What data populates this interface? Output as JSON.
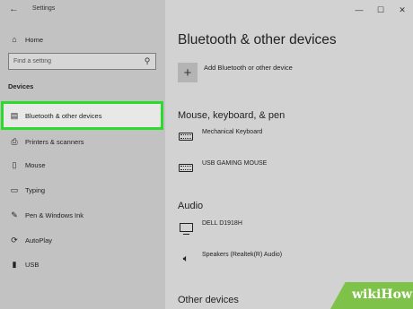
{
  "window": {
    "title": "Settings",
    "minimize": "—",
    "maximize": "☐",
    "close": "✕"
  },
  "sidebar": {
    "home_label": "Home",
    "search_placeholder": "Find a setting",
    "section_heading": "Devices",
    "items": [
      {
        "label": "Bluetooth & other devices",
        "icon": "bluetooth-device-icon"
      },
      {
        "label": "Printers & scanners",
        "icon": "printer-icon"
      },
      {
        "label": "Mouse",
        "icon": "mouse-icon"
      },
      {
        "label": "Typing",
        "icon": "keyboard-icon"
      },
      {
        "label": "Pen & Windows Ink",
        "icon": "pen-icon"
      },
      {
        "label": "AutoPlay",
        "icon": "autoplay-icon"
      },
      {
        "label": "USB",
        "icon": "usb-icon"
      }
    ],
    "active_index": 0,
    "highlight_color": "#2bdb2b"
  },
  "main": {
    "title": "Bluetooth & other devices",
    "add_label": "Add Bluetooth or other device",
    "groups": [
      {
        "heading": "Mouse, keyboard, & pen",
        "devices": [
          {
            "name": "Mechanical Keyboard",
            "icon": "keyboard-icon"
          },
          {
            "name": "USB GAMING MOUSE",
            "icon": "keyboard-icon"
          }
        ]
      },
      {
        "heading": "Audio",
        "devices": [
          {
            "name": "DELL D1918H",
            "icon": "monitor-icon"
          },
          {
            "name": "Speakers (Realtek(R) Audio)",
            "icon": "speaker-icon"
          }
        ]
      },
      {
        "heading": "Other devices",
        "devices": []
      }
    ]
  },
  "watermark": {
    "text": "wikiHow",
    "color": "#7fc24a"
  }
}
